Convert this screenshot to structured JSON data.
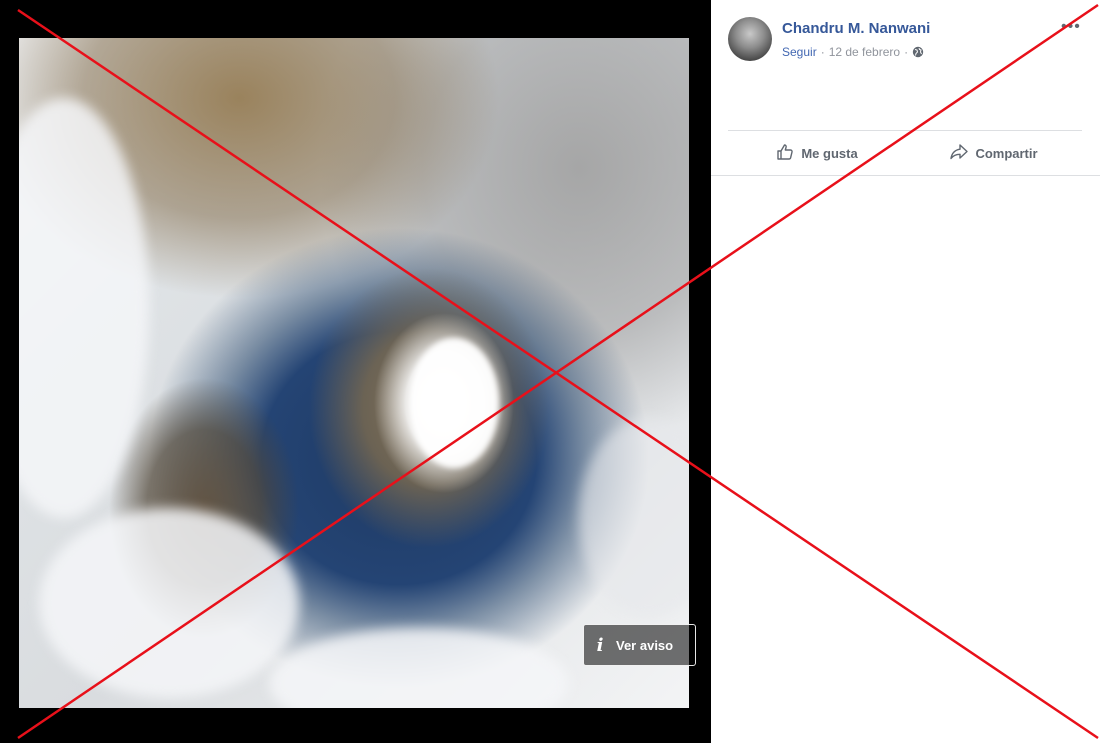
{
  "post": {
    "author": "Chandru M. Nanwani",
    "follow_label": "Seguir",
    "separator": "·",
    "date": "12 de febrero",
    "more_label": "•••"
  },
  "photo": {
    "notice_icon": "i",
    "notice_label": "Ver aviso"
  },
  "actions": {
    "like_label": "Me gusta",
    "share_label": "Compartir"
  },
  "icons": {
    "globe": "globe-icon",
    "like": "thumbs-up-icon",
    "share": "share-arrow-icon",
    "info": "info-icon"
  },
  "colors": {
    "author_link": "#365899",
    "follow_link": "#4267b2",
    "meta_text": "#90949c",
    "action_text": "#606770",
    "overlay_x": "#e8101a"
  }
}
